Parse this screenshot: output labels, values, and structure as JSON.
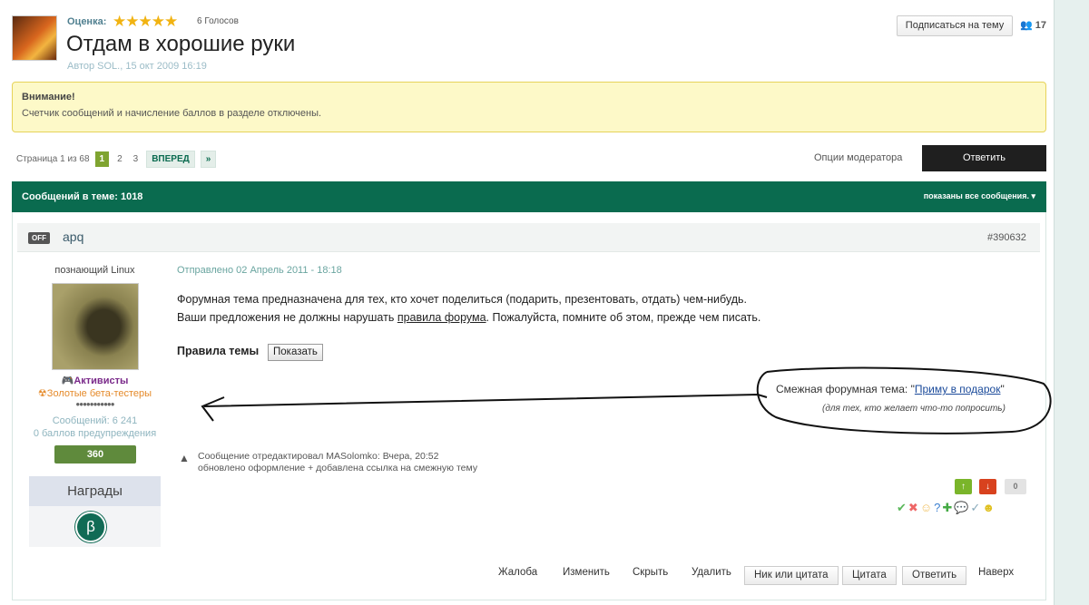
{
  "topic": {
    "rating_label": "Оценка:",
    "stars": "★★★★★",
    "votes": "6 Голосов",
    "title": "Отдам в хорошие руки",
    "author": "Автор SOL., 15 окт 2009 16:19",
    "subscribe": "Подписаться на тему",
    "followers": "17"
  },
  "notice": {
    "title": "Внимание!",
    "text": "Счетчик сообщений и начисление баллов в разделе отключены."
  },
  "pagination": {
    "label": "Страница 1 из 68",
    "pages": [
      "1",
      "2",
      "3"
    ],
    "next": "ВПЕРЕД",
    "last": "»"
  },
  "mod_options": "Опции модератора",
  "reply": "Ответить",
  "bar": {
    "count": "Сообщений в теме: 1018",
    "filter": "показаны все сообщения. ▾"
  },
  "post": {
    "status": "OFF",
    "username": "apq",
    "id": "#390632",
    "user": {
      "title": "познающий Linux",
      "group1": "Активисты",
      "group2": "Золотые бета-тестеры",
      "pips": "●●●●●●●●●●●",
      "posts": "Сообщений: 6 241",
      "warnings": "0 баллов предупреждения",
      "rep": "360",
      "awards": "Награды",
      "award_symbol": "β"
    },
    "sent": "Отправлено 02 Апрель 2011 - 18:18",
    "line1": "Форумная тема предназначена для тех, кто хочет поделиться (подарить, презентовать, отдать) чем-нибудь.",
    "line2_pre": "Ваши предложения не должны нарушать ",
    "line2_link": "правила форума",
    "line2_post": ". Пожалуйста, помните об этом, прежде чем писать.",
    "rules_label": "Правила темы",
    "show": "Показать",
    "related_pre": "Смежная форумная тема: \"",
    "related_link": "Приму в подарок",
    "related_post": "\"",
    "related_sub": "(для тех, кто желает что-то попросить)",
    "edit1": "Сообщение отредактировал MASolomko: Вчера, 20:52",
    "edit2": "обновлено оформление + добавлена ссылка на смежную тему",
    "vote_count": "0",
    "actions": {
      "report": "Жалоба",
      "edit": "Изменить",
      "hide": "Скрыть",
      "delete": "Удалить",
      "nick_quote": "Ник или цитата",
      "quote": "Цитата",
      "reply": "Ответить",
      "top": "Наверх"
    }
  }
}
